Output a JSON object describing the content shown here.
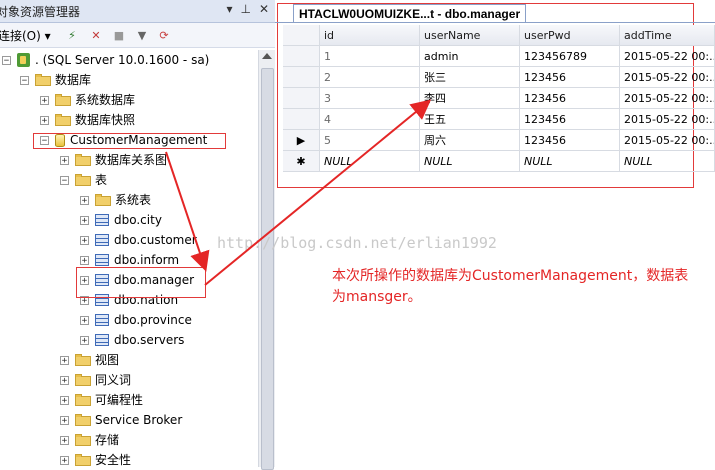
{
  "explorer": {
    "title": "对象资源管理器",
    "title_icons": [
      "pin-icon",
      "close-icon"
    ],
    "connect_label": "连接(O)",
    "tree": [
      {
        "label": ". (SQL Server 10.0.1600 - sa)",
        "icon": "server-icon",
        "expander": "−"
      },
      {
        "label": "数据库",
        "icon": "folder-icon",
        "expander": "−"
      },
      {
        "label": "系统数据库",
        "icon": "folder-icon",
        "expander": "+"
      },
      {
        "label": "数据库快照",
        "icon": "folder-icon",
        "expander": "+"
      },
      {
        "label": "CustomerManagement",
        "icon": "database-icon",
        "expander": "−"
      },
      {
        "label": "数据库关系图",
        "icon": "folder-icon",
        "expander": "+"
      },
      {
        "label": "表",
        "icon": "folder-icon",
        "expander": "−"
      },
      {
        "label": "系统表",
        "icon": "folder-icon",
        "expander": "+"
      },
      {
        "label": "dbo.city",
        "icon": "table-icon",
        "expander": "+"
      },
      {
        "label": "dbo.customer",
        "icon": "table-icon",
        "expander": "+"
      },
      {
        "label": "dbo.inform",
        "icon": "table-icon",
        "expander": "+"
      },
      {
        "label": "dbo.manager",
        "icon": "table-icon",
        "expander": "+"
      },
      {
        "label": "dbo.nation",
        "icon": "table-icon",
        "expander": "+"
      },
      {
        "label": "dbo.province",
        "icon": "table-icon",
        "expander": "+"
      },
      {
        "label": "dbo.servers",
        "icon": "table-icon",
        "expander": "+"
      },
      {
        "label": "视图",
        "icon": "folder-icon",
        "expander": "+"
      },
      {
        "label": "同义词",
        "icon": "folder-icon",
        "expander": "+"
      },
      {
        "label": "可编程性",
        "icon": "folder-icon",
        "expander": "+"
      },
      {
        "label": "Service Broker",
        "icon": "folder-icon",
        "expander": "+"
      },
      {
        "label": "存储",
        "icon": "folder-icon",
        "expander": "+"
      },
      {
        "label": "安全性",
        "icon": "folder-icon",
        "expander": "+"
      }
    ]
  },
  "document": {
    "tab_title": "HTACLW0UOMUIZKE...t - dbo.manager",
    "columns": [
      "id",
      "userName",
      "userPwd",
      "addTime"
    ],
    "rows": [
      {
        "marker": "",
        "id": "1",
        "userName": "admin",
        "userPwd": "123456789",
        "addTime": "2015-05-22 00:..."
      },
      {
        "marker": "",
        "id": "2",
        "userName": "张三",
        "userPwd": "123456",
        "addTime": "2015-05-22 00:..."
      },
      {
        "marker": "",
        "id": "3",
        "userName": "李四",
        "userPwd": "123456",
        "addTime": "2015-05-22 00:..."
      },
      {
        "marker": "",
        "id": "4",
        "userName": "王五",
        "userPwd": "123456",
        "addTime": "2015-05-22 00:..."
      },
      {
        "marker": "▶",
        "id": "5",
        "userName": "周六",
        "userPwd": "123456",
        "addTime": "2015-05-22 00:..."
      },
      {
        "marker": "✱",
        "id": "NULL",
        "userName": "NULL",
        "userPwd": "NULL",
        "addTime": "NULL"
      }
    ]
  },
  "watermark": "http://blog.csdn.net/erlian1992",
  "annotation": "本次所操作的数据库为CustomerManagement，数据表为mansger。",
  "colors": {
    "annotation": "#e42626",
    "selection": "#3b78d8"
  }
}
